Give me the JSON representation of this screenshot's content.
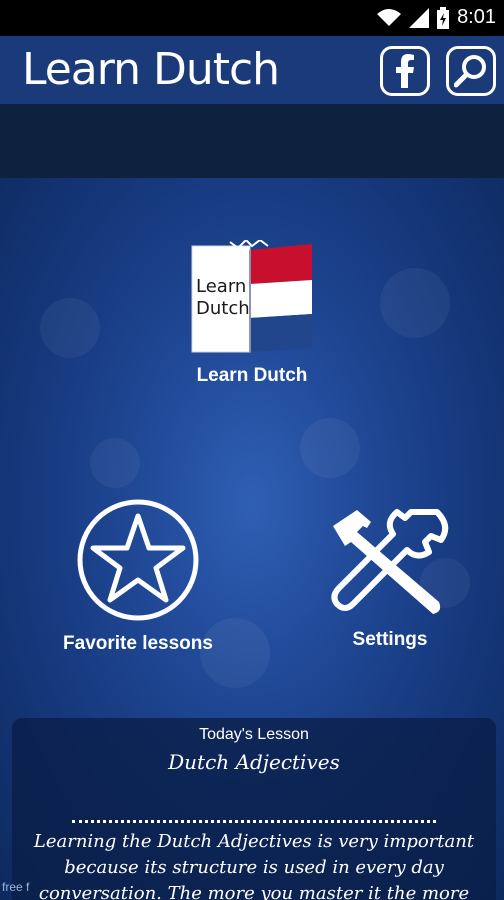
{
  "status": {
    "time": "8:01"
  },
  "app_bar": {
    "title": "Learn Dutch"
  },
  "menu": {
    "learn_label": "Learn Dutch",
    "book_text_line1": "Learn",
    "book_text_line2": "Dutch",
    "favorites_label": "Favorite lessons",
    "settings_label": "Settings"
  },
  "lesson": {
    "heading": "Today's Lesson",
    "title": "Dutch Adjectives",
    "body": "Learning the Dutch Adjectives is very important because its structure is used in every day conversation. The more you master it the more"
  },
  "footer": {
    "text": "free f"
  },
  "colors": {
    "flag_red": "#c8102e",
    "flag_white": "#ffffff",
    "flag_blue": "#21468b"
  }
}
